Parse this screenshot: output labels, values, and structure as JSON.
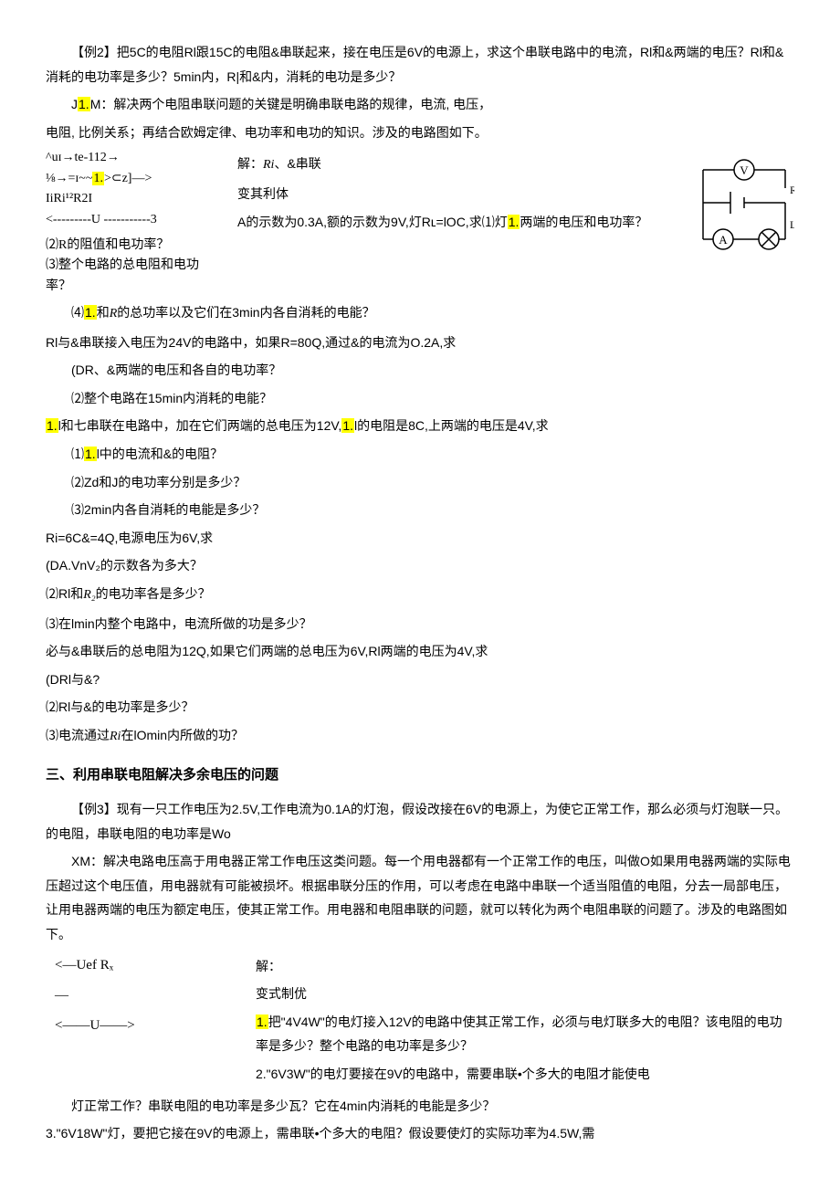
{
  "p1": "【例2】把5C的电阻Rl跟15C的电阻&串联起来，接在电压是6V的电源上，求这个串联电路中的电流，Rl和&两端的电压？Rl和&消耗的电功率是多少？5min内，R|和&内，消耗的电功是多少？",
  "p2a": "J",
  "p2b": "1.",
  "p2c": "M：解决两个电阻串联问题的关键是明确串联电路的规律，电流, 电压，",
  "p3": "电阻, 比例关系；再结合欧姆定律、电功率和电功的知识。涉及的电路图如下。",
  "left": {
    "l1": "^uɪ→te-112→",
    "l2a": "⅛→=ɪ~~",
    "l2b": "1.",
    "l2c": ">⊂z]—>",
    "l3": "IiRi¹²R2I",
    "l4": "<---------U -----------3",
    "l5": "⑵R的阻值和电功率？",
    "l6": "⑶整个电路的总电阻和电功率？"
  },
  "mid": {
    "m1a": "解：",
    "m1b": "Ri",
    "m1c": "、&串联",
    "m2": "变其利体",
    "m3a": "A的示数为0.3A,额的示数为9V,灯Rʟ=lOC,求⑴灯",
    "m3b": "1.",
    "m3c": "两端的电压和电功率？"
  },
  "p4a": "⑷",
  "p4b": "1.",
  "p4c": "和",
  "p4d": "R",
  "p4e": "的总功率以及它们在3min内各自消耗的电能？",
  "p5": "Rl与&串联接入电压为24V的电路中，如果R=80Q,通过&的电流为O.2A,求",
  "p6": "(DR、&两端的电压和各自的电功率？",
  "p7": "⑵整个电路在15min内消耗的电能？",
  "p8a": "1.",
  "p8b": "l和七串联在电路中，加在它们两端的总电压为12V,",
  "p8c": "1.",
  "p8d": "l的电阻是8C,上两端的电压是4V,求",
  "p9a": "⑴",
  "p9b": "1.",
  "p9c": "l中的电流和&的电阻？",
  "p10": "⑵Zd和J的电功率分别是多少？",
  "p11": "⑶2min内各自消耗的电能是多少？",
  "p12": "Ri=6C&=4Q,电源电压为6V,求",
  "p13": "(DA.VnV₂的示数各为多大？",
  "p14a": "⑵Rl和",
  "p14b": "R₂",
  "p14c": "的电功率各是多少？",
  "p15": "⑶在lmin内整个电路中，电流所做的功是多少？",
  "p16": "必与&串联后的总电阻为12Q,如果它们两端的总电压为6V,Rl两端的电压为4V,求",
  "p17": "(DRl与&?",
  "p18": "⑵Rl与&的电功率是多少？",
  "p19a": "⑶电流通过",
  "p19b": "Ri",
  "p19c": "在lOmin内所做的功？",
  "h1": "三、利用串联电阻解决多余电压的问题",
  "p20": "【例3】现有一只工作电压为2.5V,工作电流为0.1A的灯泡，假设改接在6V的电源上，为使它正常工作，那么必须与灯泡联一只。的电阻，串联电阻的电功率是Wo",
  "p21": "XM：解决电路电压高于用电器正常工作电压这类问题。每一个用电器都有一个正常工作的电压，叫做O如果用电器两端的实际电压超过这个电压值，用电器就有可能被损坏。根据串联分压的作用，可以考虑在电路中串联一个适当阻值的电阻，分去一局部电压，让用电器两端的电压为额定电压，使其正常工作。用电器和电阻串联的问题，就可以转化为两个电阻串联的问题了。涉及的电路图如下。",
  "dg": {
    "d1": "<—Uef       Rₓ",
    "d2": "—",
    "d3": "<——U——>"
  },
  "right": {
    "r1": "解：",
    "r2": "变式制优",
    "r3a": "1.",
    "r3b": "把\"4V4W\"的电灯接入12V的电路中使其正常工作，必须与电灯联多大的电阻？该电阻的电功率是多少？整个电路的电功率是多少？",
    "r4": "2.\"6V3W\"的电灯要接在9V的电路中，需要串联•个多大的电阻才能使电"
  },
  "p22": "灯正常工作？串联电阻的电功率是多少瓦？它在4min内消耗的电能是多少？",
  "p23": "3.\"6V18W\"灯，要把它接在9V的电源上，需串联•个多大的电阻？假设要使灯的实际功率为4.5W,需"
}
